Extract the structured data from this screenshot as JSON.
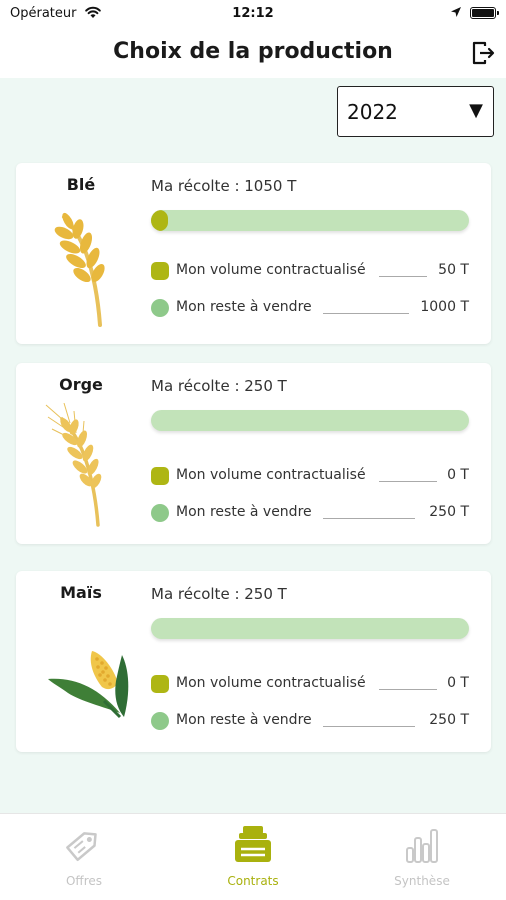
{
  "status_bar": {
    "carrier": "Opérateur",
    "time": "12:12"
  },
  "header": {
    "title": "Choix de la production",
    "logout_icon": "logout-icon"
  },
  "year_select": {
    "value": "2022"
  },
  "crops": [
    {
      "name": "Blé",
      "harvest_label": "Ma récolte : 1050 T",
      "contracted_fraction": 0.048,
      "contracted_label": "Mon volume contractualisé",
      "contracted_value": "50 T",
      "remaining_label": "Mon reste à vendre",
      "remaining_value": "1000 T",
      "icon": "wheat-icon"
    },
    {
      "name": "Orge",
      "harvest_label": "Ma récolte : 250 T",
      "contracted_fraction": 0,
      "contracted_label": "Mon volume contractualisé",
      "contracted_value": "0 T",
      "remaining_label": "Mon reste à vendre",
      "remaining_value": "250 T",
      "icon": "barley-icon"
    },
    {
      "name": "Maïs",
      "harvest_label": "Ma récolte : 250 T",
      "contracted_fraction": 0,
      "contracted_label": "Mon volume contractualisé",
      "contracted_value": "0 T",
      "remaining_label": "Mon reste à vendre",
      "remaining_value": "250 T",
      "icon": "corn-icon"
    }
  ],
  "colors": {
    "contracted": "#aeb614",
    "remaining": "#8ec98a",
    "track": "#c2e3b9",
    "background": "#eef8f4",
    "active_tab": "#a9b10e"
  },
  "tabs": [
    {
      "label": "Offres",
      "icon": "price-tag-icon",
      "active": false
    },
    {
      "label": "Contrats",
      "icon": "contracts-stack-icon",
      "active": true
    },
    {
      "label": "Synthèse",
      "icon": "bar-chart-icon",
      "active": false
    }
  ]
}
